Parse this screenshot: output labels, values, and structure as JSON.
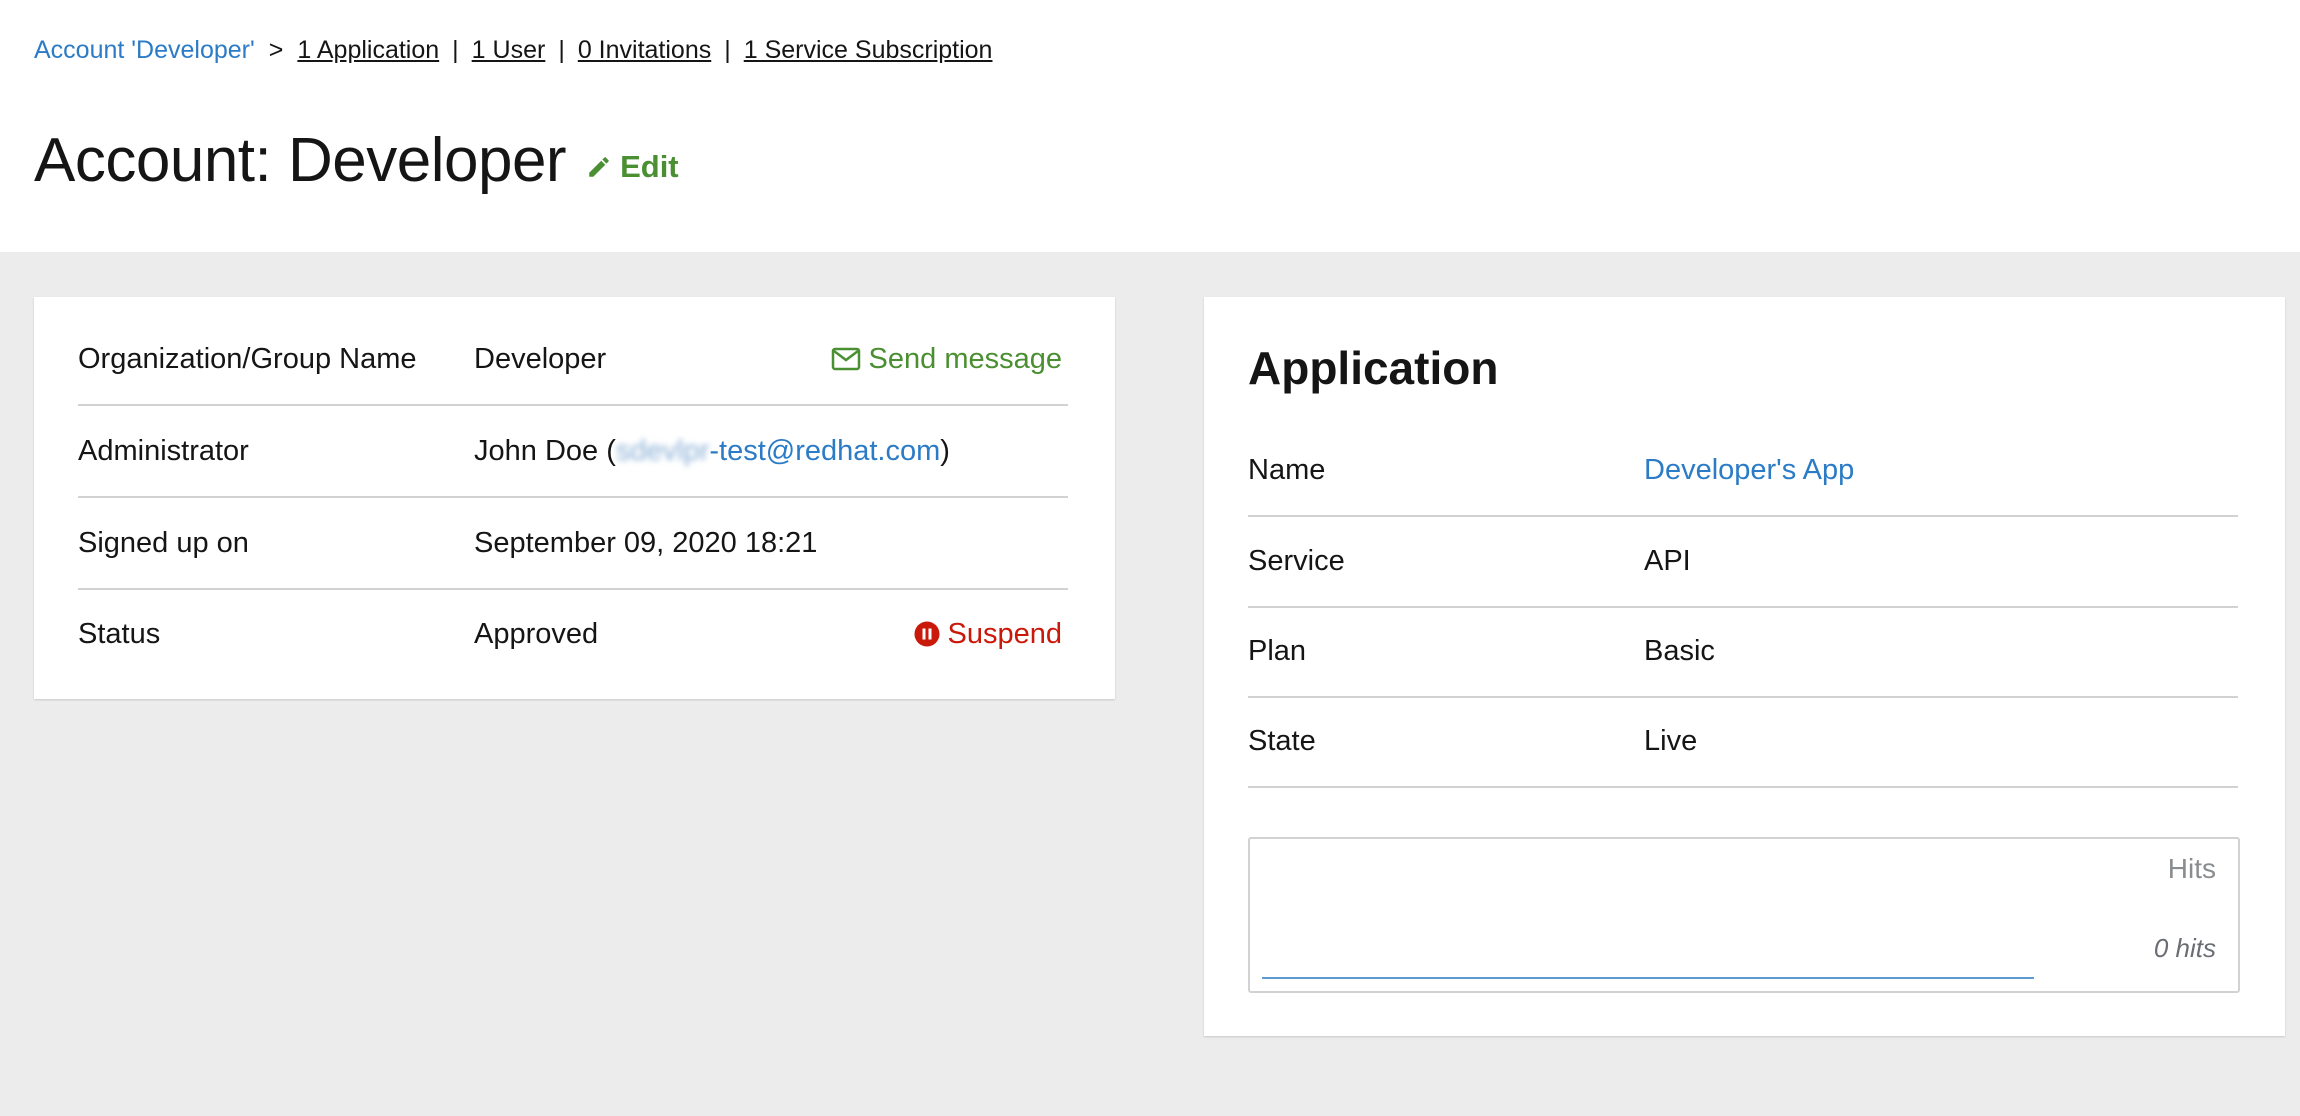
{
  "breadcrumb": {
    "root": "Account 'Developer'",
    "separator": ">",
    "links": [
      "1 Application",
      "1 User",
      "0 Invitations",
      "1 Service Subscription"
    ],
    "divider": "|"
  },
  "header": {
    "title": "Account: Developer",
    "edit_label": "Edit"
  },
  "account": {
    "rows": [
      {
        "label": "Organization/Group Name",
        "value": "Developer",
        "action": "Send message"
      },
      {
        "label": "Administrator",
        "value_prefix": "John Doe (",
        "email_blurred": "sdevlpr",
        "email_visible": "-test@redhat.com",
        "value_suffix": ")"
      },
      {
        "label": "Signed up on",
        "value": "September 09, 2020 18:21"
      },
      {
        "label": "Status",
        "value": "Approved",
        "action": "Suspend"
      }
    ]
  },
  "application": {
    "title": "Application",
    "rows": [
      {
        "label": "Name",
        "value": "Developer's App"
      },
      {
        "label": "Service",
        "value": "API"
      },
      {
        "label": "Plan",
        "value": "Basic"
      },
      {
        "label": "State",
        "value": "Live"
      }
    ],
    "hits": {
      "label": "Hits",
      "value": "0 hits"
    }
  },
  "colors": {
    "link_blue": "#2b7bc6",
    "action_green": "#4a8f32",
    "danger_red": "#c9190b",
    "background": "#ececec"
  }
}
